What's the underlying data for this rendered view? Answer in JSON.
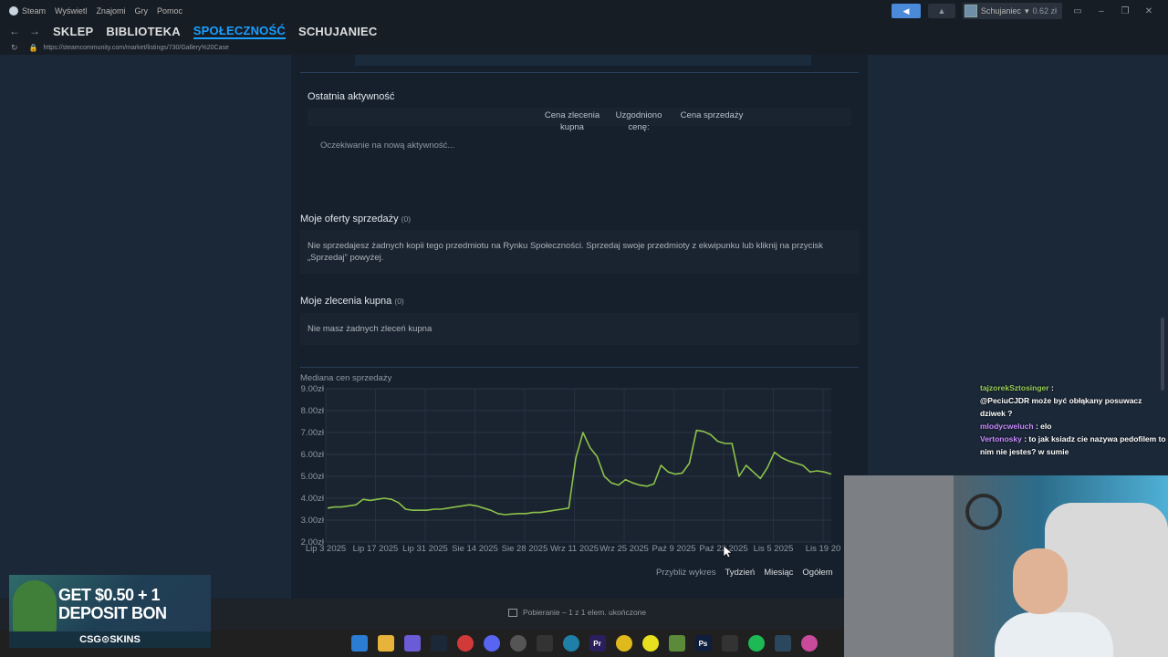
{
  "menubar": {
    "app": "Steam",
    "items": [
      "Wyświetl",
      "Znajomi",
      "Gry",
      "Pomoc"
    ],
    "user_name": "Schujaniec",
    "user_balance": "0.62 zł"
  },
  "nav": {
    "links": [
      "SKLEP",
      "BIBLIOTEKA",
      "SPOŁECZNOŚĆ",
      "SCHUJANIEC"
    ],
    "active": "SPOŁECZNOŚĆ",
    "url": "https://steamcommunity.com/market/listings/730/Gallery%20Case"
  },
  "activity": {
    "title": "Ostatnia aktywność",
    "col_buy_1": "Cena zlecenia",
    "col_buy_2": "kupna",
    "col_agreed_1": "Uzgodniono",
    "col_agreed_2": "cenę:",
    "col_sell": "Cena sprzedaży",
    "waiting": "Oczekiwanie na nową aktywność..."
  },
  "offers": {
    "title": "Moje oferty sprzedaży",
    "count": "(0)",
    "text_1": "Nie sprzedajesz żadnych kopii tego przedmiotu na Rynku Społeczności. Sprzedaj swoje przedmioty z ekwipunku lub kliknij na przycisk",
    "text_2": "„Sprzedaj” powyżej."
  },
  "orders": {
    "title": "Moje zlecenia kupna",
    "count": "(0)",
    "text": "Nie masz żadnych zleceń kupna"
  },
  "zoom": {
    "label": "Przybliż wykres",
    "week": "Tydzień",
    "month": "Miesiąc",
    "all": "Ogółem"
  },
  "status": {
    "text": "Pobieranie – 1 z 1 elem. ukończone"
  },
  "ad": {
    "line1": "GET $0.50 + 1",
    "line2": "DEPOSIT BON",
    "brand": "CSG⊙SKINS"
  },
  "chat": [
    {
      "user": "tajzorekSztosinger",
      "text": ":"
    },
    {
      "user": "",
      "text": "@PeciuCJDR może być obłąkany posuwacz dziwek  ?"
    },
    {
      "user": "mlodycweluch",
      "text": ": elo"
    },
    {
      "user": "Vertonosky",
      "text": ": to jak ksiadz cie nazywa pedofilem to nim nie jestes? w sumie"
    }
  ],
  "colors": {
    "line": "#8bc34a",
    "accent": "#1a9fff",
    "bg": "#1b2838"
  },
  "chart_data": {
    "type": "line",
    "title": "Mediana cen sprzedaży",
    "ylim": [
      2,
      9
    ],
    "y_ticks": [
      "9.00zł",
      "8.00zł",
      "7.00zł",
      "6.00zł",
      "5.00zł",
      "4.00zł",
      "3.00zł",
      "2.00zł"
    ],
    "x_ticks": [
      "Lip 3 2025",
      "Lip 17 2025",
      "Lip 31 2025",
      "Sie 14 2025",
      "Sie 28 2025",
      "Wrz 11 2025",
      "Wrz 25 2025",
      "Paź 9 2025",
      "Paź 23 2025",
      "Lis 5 2025",
      "Lis 19 20"
    ],
    "series": [
      {
        "values": [
          3.55,
          3.6,
          3.6,
          3.65,
          3.7,
          3.95,
          3.9,
          3.95,
          4.0,
          3.95,
          3.8,
          3.5,
          3.45,
          3.45,
          3.45,
          3.5,
          3.5,
          3.55,
          3.6,
          3.65,
          3.7,
          3.65,
          3.55,
          3.45,
          3.3,
          3.25,
          3.28,
          3.3,
          3.3,
          3.35,
          3.35,
          3.4,
          3.45,
          3.5,
          3.55,
          5.85,
          7.0,
          6.3,
          5.9,
          5.0,
          4.7,
          4.6,
          4.85,
          4.7,
          4.6,
          4.55,
          4.65,
          5.5,
          5.2,
          5.1,
          5.15,
          5.6,
          7.1,
          7.05,
          6.9,
          6.6,
          6.5,
          6.5,
          5.0,
          5.5,
          5.2,
          4.9,
          5.4,
          6.1,
          5.85,
          5.7,
          5.6,
          5.5,
          5.2,
          5.25,
          5.2,
          5.1
        ]
      }
    ]
  }
}
